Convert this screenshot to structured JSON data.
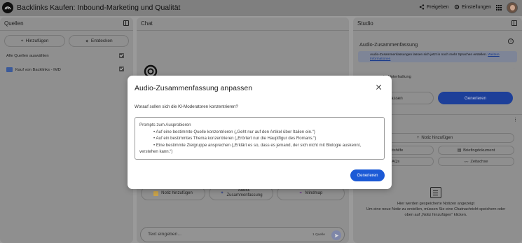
{
  "app": {
    "title": "Backlinks Kaufen: Inbound-Marketing und Qualität",
    "share_label": "Freigeben",
    "settings_label": "Einstellungen"
  },
  "sources": {
    "heading": "Quellen",
    "add_label": "Hinzufügen",
    "discover_label": "Entdecken",
    "select_all_label": "Alle Quellen auswählen",
    "items": [
      {
        "label": "Kauf von Backlinks - IMD"
      }
    ]
  },
  "chat": {
    "heading": "Chat",
    "chips": [
      {
        "label": "Notiz hinzufügen"
      },
      {
        "label": "Audio-Zusammenfassung"
      },
      {
        "label": "Mindmap"
      }
    ],
    "input_placeholder": "Text eingeben...",
    "source_count": "1 Quelle"
  },
  "studio": {
    "heading": "Studio",
    "section_title": "Audio-Zusammenfassung",
    "banner_text": "Audio-Zusammenfassungen lassen sich jetzt in noch mehr Sprachen erstellen.",
    "banner_link": "Weitere Informationen",
    "card_title_partial": "erte Unterhaltung",
    "card_subtitle_partial": "ith",
    "customize_partial": "npassen",
    "generate_label": "Generieren",
    "add_note_label": "Notiz hinzufügen",
    "buttons": [
      {
        "label": "rbeitshilfe"
      },
      {
        "label": "Briefingdokument"
      },
      {
        "label": "FAQs"
      },
      {
        "label": "Zeitachse"
      }
    ],
    "notes_empty_title": "Hier werden gespeicherte Notizen angezeigt",
    "notes_empty_line1": "Um eine neue Notiz zu erstellen, müssen Sie eine Chatnachricht speichern oder",
    "notes_empty_line2": "oben auf „Notiz hinzufügen“ klicken."
  },
  "modal": {
    "title": "Audio-Zusammenfassung anpassen",
    "question": "Worauf sollen sich die KI-Moderatoren konzentrieren?",
    "prompts_heading": "Prompts zum Ausprobieren",
    "prompt_1": "• Auf eine bestimmte Quelle konzentrieren („Geht nur auf den Artikel über Italien ein.“)",
    "prompt_2": "• Auf ein bestimmtes Thema konzentrieren („Erörtert nur die Hauptfigur des Romans.“)",
    "prompt_3": "• Eine bestimmte Zielgruppe ansprechen („Erklärt es so, dass es jemand, der sich nicht mit Biologie auskennt,",
    "prompt_3_cont": "verstehen kann.“)",
    "generate_label": "Generieren"
  },
  "colors": {
    "accent_blue": "#1c5ad6",
    "studio_generate": "#1d3f99",
    "overlay_gray": "#9a9a9a"
  }
}
